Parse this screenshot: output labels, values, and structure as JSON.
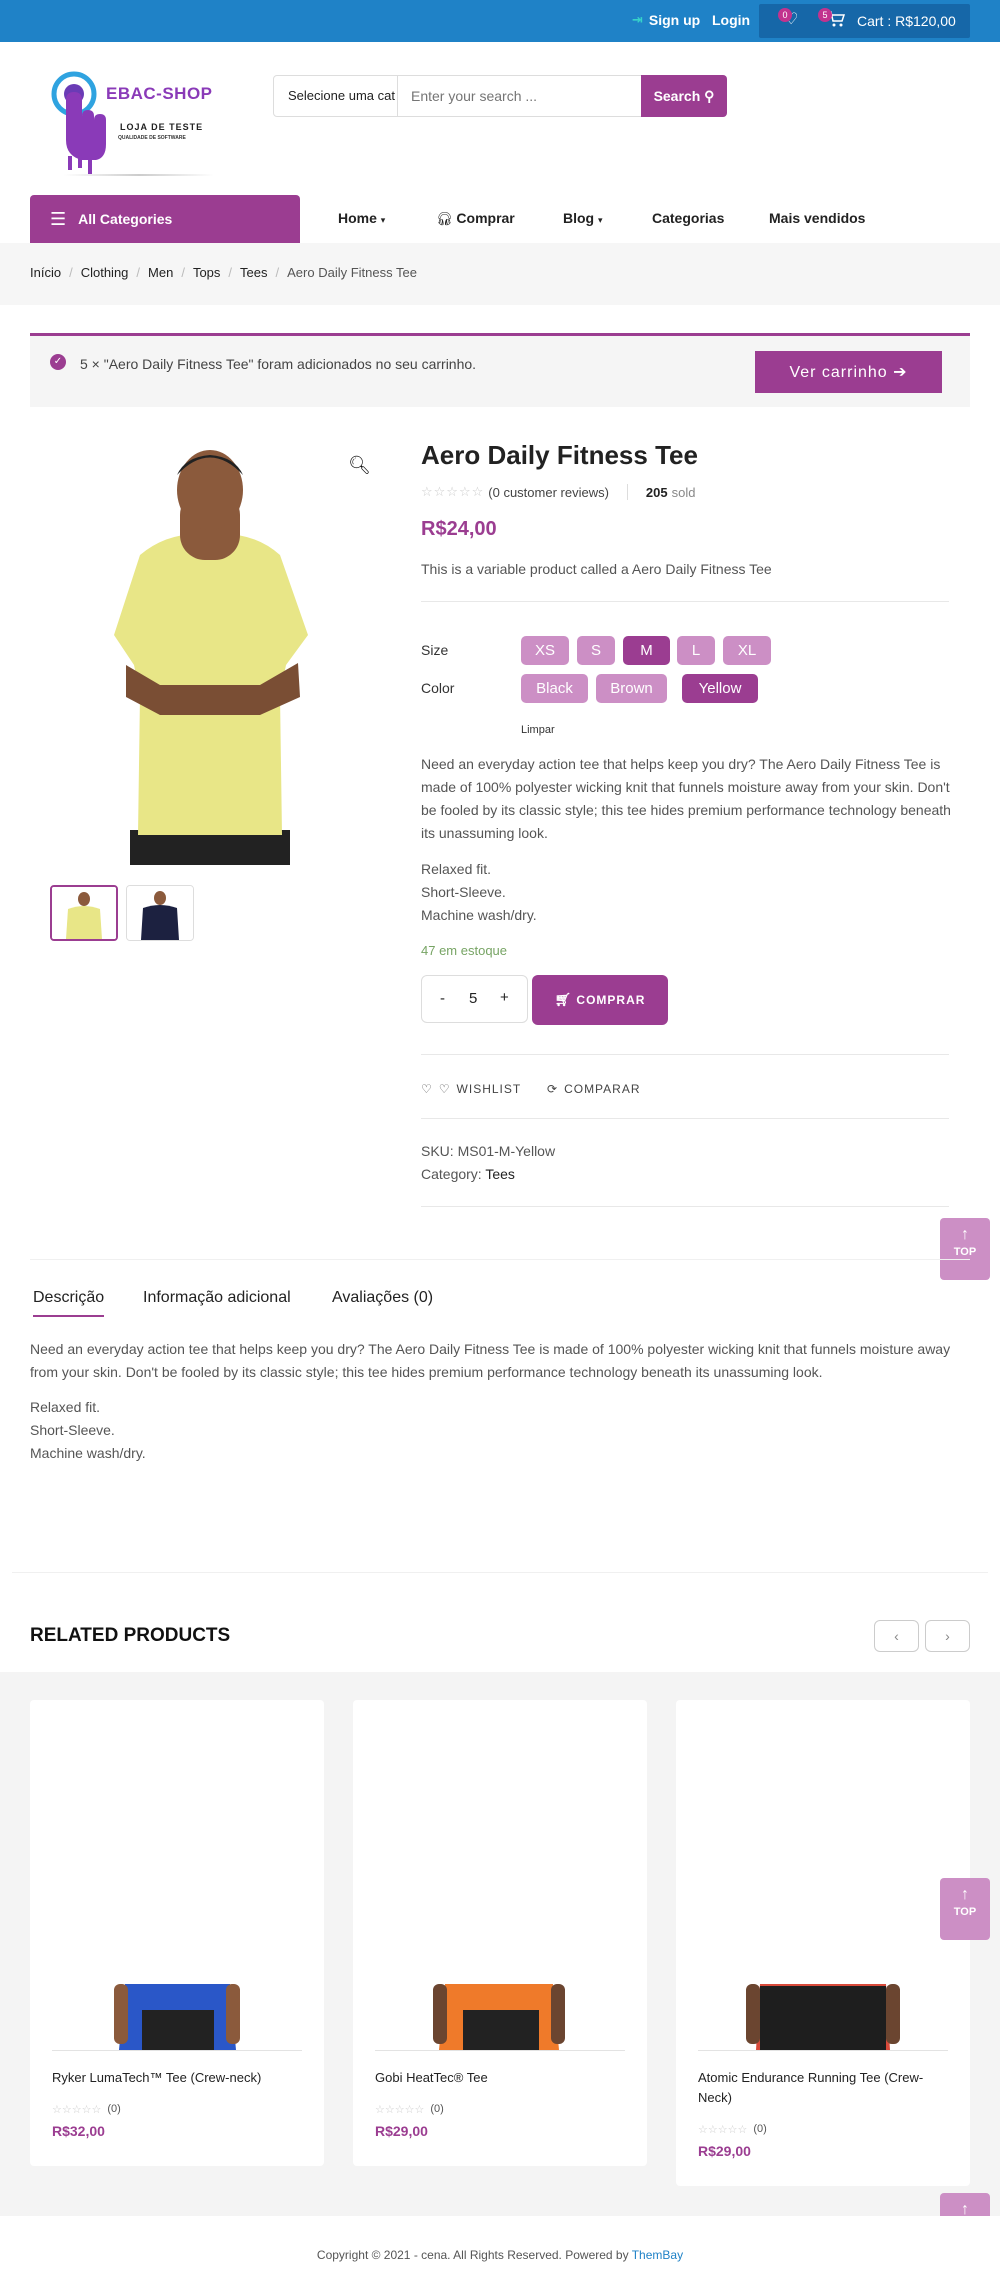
{
  "topbar": {
    "signup": "Sign up",
    "login": "Login",
    "wishlist_count": "0",
    "cart_count": "5",
    "cart_label": "Cart : R$120,00"
  },
  "logo": {
    "brand": "EBAC-SHOP",
    "line1": "LOJA DE TESTE",
    "line2": "QUALIDADE DE SOFTWARE"
  },
  "search": {
    "category": "Selecione uma cat",
    "placeholder": "Enter your search ...",
    "button": "Search"
  },
  "nav": {
    "all_categories": "All Categories",
    "home": "Home",
    "comprar": "Comprar",
    "blog": "Blog",
    "categorias": "Categorias",
    "mais_vendidos": "Mais vendidos"
  },
  "breadcrumb": [
    "Início",
    "Clothing",
    "Men",
    "Tops",
    "Tees",
    "Aero Daily Fitness Tee"
  ],
  "notice": {
    "text": "5 × \"Aero Daily Fitness Tee\" foram adicionados no seu carrinho.",
    "button": "Ver carrinho"
  },
  "product": {
    "title": "Aero Daily Fitness Tee",
    "reviews": "(0 customer reviews)",
    "sold_count": "205",
    "sold_label": "sold",
    "price": "R$24,00",
    "short_description": "This is a variable product called a Aero Daily Fitness Tee",
    "size_label": "Size",
    "sizes": [
      "XS",
      "S",
      "M",
      "L",
      "XL"
    ],
    "selected_size": "M",
    "color_label": "Color",
    "colors": [
      "Black",
      "Brown",
      "Yellow"
    ],
    "selected_color": "Yellow",
    "clear": "Limpar",
    "description": "Need an everyday action tee that helps keep you dry? The Aero Daily Fitness Tee is made of 100% polyester wicking knit that funnels moisture away from your skin. Don't be fooled by its classic style; this tee hides premium performance technology beneath its unassuming look.",
    "features": [
      "Relaxed fit.",
      "Short-Sleeve.",
      "Machine wash/dry."
    ],
    "stock": "47 em estoque",
    "quantity": "5",
    "buy_button": "COMPRAR",
    "wishlist": "WISHLIST",
    "compare": "COMPARAR",
    "sku": "SKU: MS01-M-Yellow",
    "category_label": "Category:",
    "category_value": "Tees"
  },
  "tabs": {
    "description": "Descrição",
    "additional": "Informação adicional",
    "reviews": "Avaliações (0)"
  },
  "tab_content": {
    "description": "Need an everyday action tee that helps keep you dry? The Aero Daily Fitness Tee is made of 100% polyester wicking knit that funnels moisture away from your skin. Don't be fooled by its classic style; this tee hides premium performance technology beneath its unassuming look.",
    "features": [
      "Relaxed fit.",
      "Short-Sleeve.",
      "Machine wash/dry."
    ]
  },
  "top_label": "TOP",
  "related": {
    "title": "RELATED PRODUCTS",
    "items": [
      {
        "name": "Ryker LumaTech™ Tee (Crew-neck)",
        "reviews": "(0)",
        "price": "R$32,00",
        "shirt_color": "#2a57c8"
      },
      {
        "name": "Gobi HeatTec® Tee",
        "reviews": "(0)",
        "price": "R$29,00",
        "shirt_color": "#ef7a2a"
      },
      {
        "name": "Atomic Endurance Running Tee (Crew-Neck)",
        "reviews": "(0)",
        "price": "R$29,00",
        "shirt_color": "#d84a3a"
      }
    ]
  },
  "footer": {
    "copyright": "Copyright © 2021 - cena. All Rights Reserved. Powered by",
    "powered": "ThemBay"
  },
  "colors": {
    "accent": "#9b3d91",
    "topbar": "#1f82c7",
    "swatch": "#cc8fc5",
    "stock": "#77a464"
  }
}
